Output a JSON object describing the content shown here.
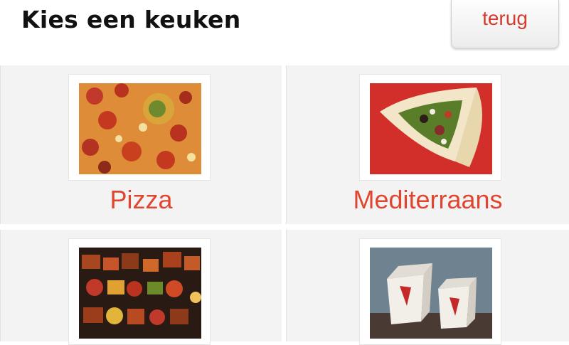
{
  "header": {
    "title": "Kies een keuken",
    "back_label": "terug"
  },
  "cuisines": [
    {
      "label": "Pizza",
      "icon": "pizza-photo"
    },
    {
      "label": "Mediterraans",
      "icon": "wrap-photo"
    },
    {
      "label": "",
      "icon": "grill-skewers-photo"
    },
    {
      "label": "",
      "icon": "chinese-takeout-boxes-photo"
    }
  ],
  "colors": {
    "accent": "#e0452f",
    "tile_background": "#f3f3f3",
    "title": "#111111"
  }
}
